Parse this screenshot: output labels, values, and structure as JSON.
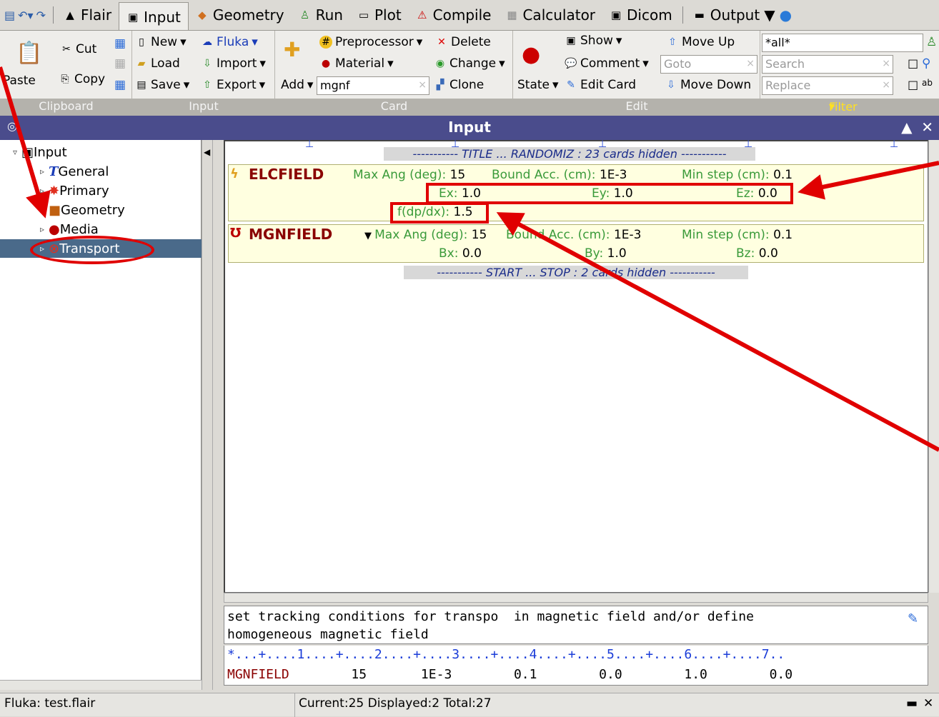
{
  "tabs": [
    {
      "label": "Flair",
      "icon": "flair-icon"
    },
    {
      "label": "Input",
      "icon": "input-icon",
      "active": true
    },
    {
      "label": "Geometry",
      "icon": "geometry-icon"
    },
    {
      "label": "Run",
      "icon": "run-icon"
    },
    {
      "label": "Plot",
      "icon": "plot-icon"
    },
    {
      "label": "Compile",
      "icon": "compile-icon"
    },
    {
      "label": "Calculator",
      "icon": "calculator-icon"
    },
    {
      "label": "Dicom",
      "icon": "dicom-icon"
    },
    {
      "label": "Output",
      "icon": "output-icon"
    }
  ],
  "ribbon": {
    "clipboard": {
      "paste": "Paste",
      "cut": "Cut",
      "copy": "Copy"
    },
    "input": {
      "new": "New",
      "load": "Load",
      "save": "Save",
      "fluka": "Fluka",
      "import": "Import",
      "export": "Export"
    },
    "card": {
      "preprocessor": "Preprocessor",
      "material": "Material",
      "add": "Add",
      "add_value": "mgnf",
      "delete": "Delete",
      "change": "Change",
      "clone": "Clone"
    },
    "edit": {
      "show": "Show",
      "comment": "Comment",
      "state": "State",
      "edit_card": "Edit Card",
      "move_up": "Move Up",
      "move_down": "Move Down",
      "goto_placeholder": "Goto"
    },
    "filter": {
      "value": "*all*",
      "search_placeholder": "Search",
      "replace_placeholder": "Replace"
    }
  },
  "group_labels": {
    "clipboard": "Clipboard",
    "input": "Input",
    "card": "Card",
    "edit": "Edit",
    "filter": "Filter"
  },
  "panel_title": "Input",
  "tree": [
    {
      "label": "Input"
    },
    {
      "label": "General"
    },
    {
      "label": "Primary"
    },
    {
      "label": "Geometry"
    },
    {
      "label": "Media"
    },
    {
      "label": "Transport"
    }
  ],
  "hidden_top": "----------- TITLE ... RANDOMIZ : 23 cards hidden -----------",
  "hidden_bottom": "----------- START ... STOP : 2 cards hidden -----------",
  "cards": {
    "elcfield": {
      "name": "ELCFIELD",
      "max_ang_label": "Max Ang (deg):",
      "max_ang": "15",
      "bound_acc_label": "Bound Acc. (cm):",
      "bound_acc": "1E-3",
      "min_step_label": "Min step (cm):",
      "min_step": "0.1",
      "ex_label": "Ex:",
      "ex": "1.0",
      "ey_label": "Ey:",
      "ey": "1.0",
      "ez_label": "Ez:",
      "ez": "0.0",
      "fdp_label": "f(dp/dx):",
      "fdp": "1.5"
    },
    "mgnfield": {
      "name": "MGNFIELD",
      "max_ang_label": "Max Ang (deg):",
      "max_ang": "15",
      "bound_acc_label": "Bound Acc. (cm):",
      "bound_acc": "1E-3",
      "min_step_label": "Min step (cm):",
      "min_step": "0.1",
      "bx_label": "Bx:",
      "bx": "0.0",
      "by_label": "By:",
      "by": "1.0",
      "bz_label": "Bz:",
      "bz": "0.0"
    }
  },
  "description": "set tracking conditions for transpo  in magnetic field and/or define\nhomogeneous magnetic field",
  "ruler": "*...+....1....+....2....+....3....+....4....+....5....+....6....+....7..",
  "outline": {
    "name": "MGNFIELD",
    "values": "        15       1E-3        0.1        0.0        1.0        0.0"
  },
  "status": {
    "file": "Fluka: test.flair",
    "counts": "Current:25  Displayed:2 Total:27"
  }
}
